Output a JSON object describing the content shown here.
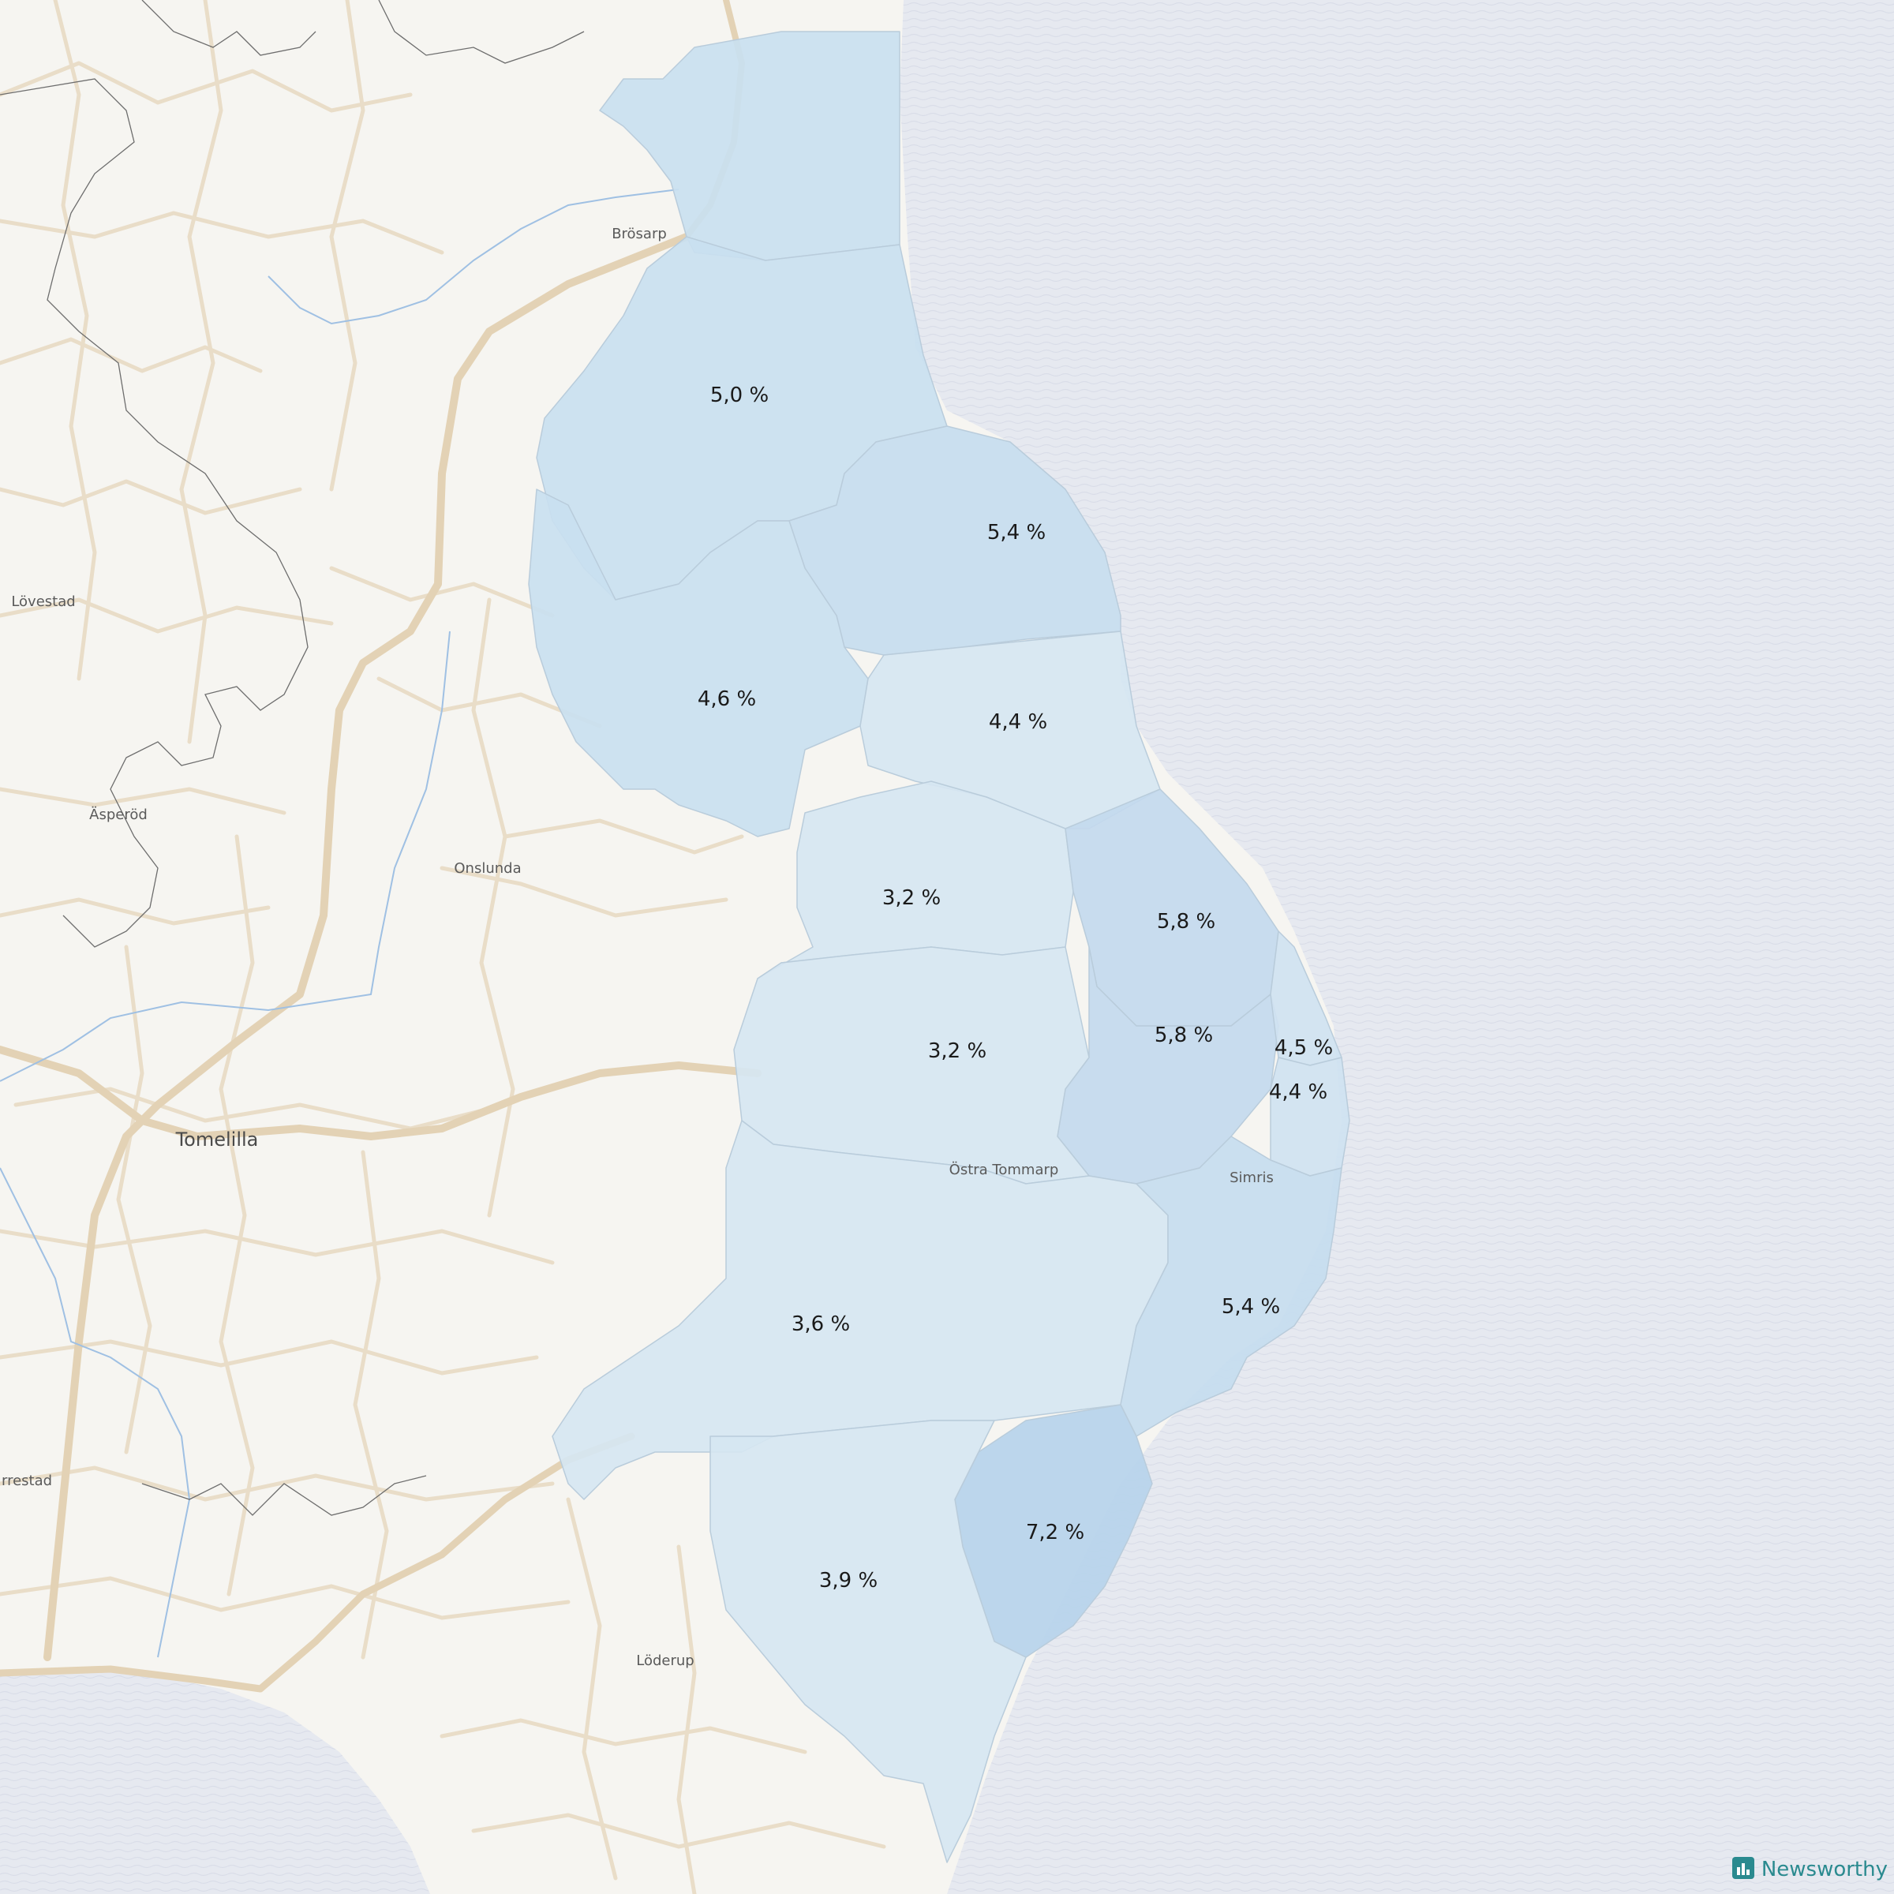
{
  "places": {
    "brosarp": "Brösarp",
    "lovestad": "Lövestad",
    "asperod": "Äsperöd",
    "onslunda": "Onslunda",
    "tomelilla": "Tomelilla",
    "ostra_tommarp": "Östra Tommarp",
    "simris": "Simris",
    "loderup": "Löderup",
    "rrestad": "rrestad"
  },
  "regions": [
    {
      "label": "5,0 %",
      "value": 5.0
    },
    {
      "label": "5,4 %",
      "value": 5.4
    },
    {
      "label": "4,6 %",
      "value": 4.6
    },
    {
      "label": "4,4 %",
      "value": 4.4
    },
    {
      "label": "3,2 %",
      "value": 3.2
    },
    {
      "label": "5,8 %",
      "value": 5.8
    },
    {
      "label": "5,8 %",
      "value": 5.8
    },
    {
      "label": "3,2 %",
      "value": 3.2
    },
    {
      "label": "4,5 %",
      "value": 4.5
    },
    {
      "label": "4,4 %",
      "value": 4.4
    },
    {
      "label": "3,6 %",
      "value": 3.6
    },
    {
      "label": "5,4 %",
      "value": 5.4
    },
    {
      "label": "7,2 %",
      "value": 7.2
    },
    {
      "label": "3,9 %",
      "value": 3.9
    }
  ],
  "brand": {
    "name": "Newsworthy",
    "icon": "bar-chart-icon"
  },
  "colors": {
    "land": "#f6f5f1",
    "sea": "#e6e9f0",
    "road": "#e9ddc8",
    "highway": "#e3d2b5",
    "region_light": "#d6e6f2",
    "region_mid": "#c9dff0",
    "region_dark": "#b8d4eb",
    "brand": "#2a8a8f"
  }
}
